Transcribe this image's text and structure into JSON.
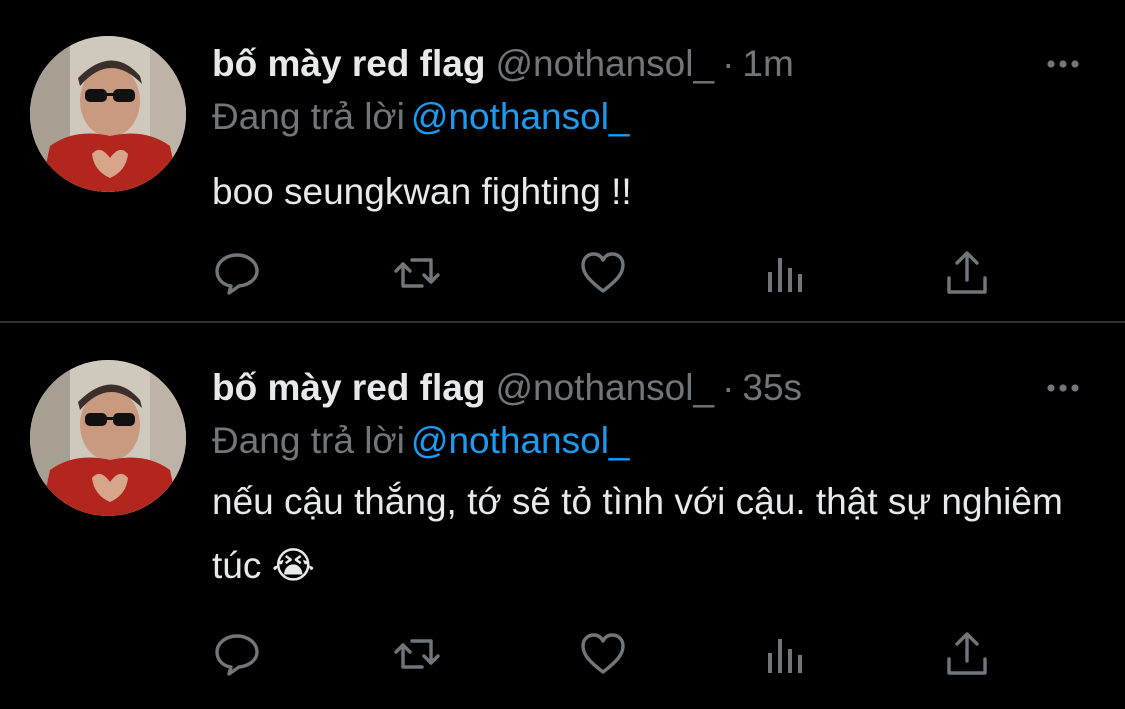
{
  "tweets": [
    {
      "display_name": "bố mày red flag",
      "handle": "@nothansol_",
      "separator": "·",
      "time": "1m",
      "reply_prefix": "Đang trả lời",
      "reply_mention": "@nothansol_",
      "text": "boo seungkwan fighting !!",
      "avatar": "profile-photo",
      "action_icons": [
        "reply-icon",
        "retweet-icon",
        "like-icon",
        "analytics-icon",
        "share-icon"
      ]
    },
    {
      "display_name": "bố mày red flag",
      "handle": "@nothansol_",
      "separator": "·",
      "time": "35s",
      "reply_prefix": "Đang trả lời",
      "reply_mention": "@nothansol_",
      "text": "nếu cậu thắng, tớ sẽ tỏ tình với cậu. thật sự nghiêm túc 😭",
      "avatar": "profile-photo",
      "action_icons": [
        "reply-icon",
        "retweet-icon",
        "like-icon",
        "analytics-icon",
        "share-icon"
      ]
    }
  ],
  "colors": {
    "background": "#000000",
    "primary_text": "#e7e9ea",
    "secondary_text": "#71767b",
    "mention": "#1d9bf0",
    "divider": "#2f3336"
  }
}
